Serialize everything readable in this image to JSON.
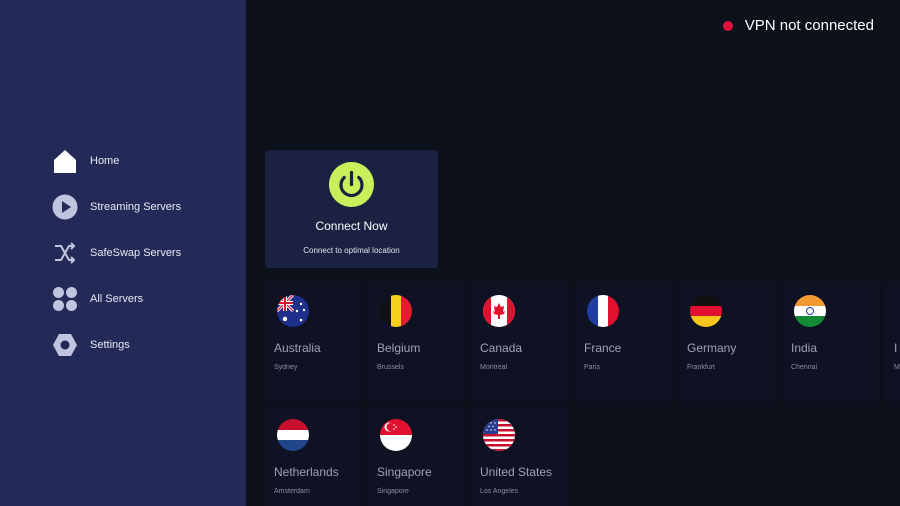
{
  "status": {
    "text": "VPN not connected",
    "dot_color": "#e0103a"
  },
  "sidebar": {
    "items": [
      {
        "label": "Home",
        "icon": "home-icon"
      },
      {
        "label": "Streaming Servers",
        "icon": "play-icon"
      },
      {
        "label": "SafeSwap Servers",
        "icon": "shuffle-icon"
      },
      {
        "label": "All Servers",
        "icon": "grid-icon"
      },
      {
        "label": "Settings",
        "icon": "hexagon-settings-icon"
      }
    ]
  },
  "connect": {
    "title": "Connect Now",
    "subtitle": "Connect to optimal location",
    "button_color": "#c7f05a",
    "icon": "power-icon"
  },
  "servers": [
    {
      "country": "Australia",
      "city": "Sydney",
      "flag": "australia-flag-icon"
    },
    {
      "country": "Belgium",
      "city": "Brussels",
      "flag": "belgium-flag-icon"
    },
    {
      "country": "Canada",
      "city": "Montreal",
      "flag": "canada-flag-icon"
    },
    {
      "country": "France",
      "city": "Paris",
      "flag": "france-flag-icon"
    },
    {
      "country": "Germany",
      "city": "Frankfurt",
      "flag": "germany-flag-icon"
    },
    {
      "country": "India",
      "city": "Chennai",
      "flag": "india-flag-icon"
    },
    {
      "country": "I",
      "city": "M",
      "flag": "partial-flag-icon"
    },
    {
      "country": "Netherlands",
      "city": "Amsterdam",
      "flag": "netherlands-flag-icon"
    },
    {
      "country": "Singapore",
      "city": "Singapore",
      "flag": "singapore-flag-icon"
    },
    {
      "country": "United States",
      "city": "Los Angeles",
      "flag": "united-states-flag-icon"
    }
  ]
}
